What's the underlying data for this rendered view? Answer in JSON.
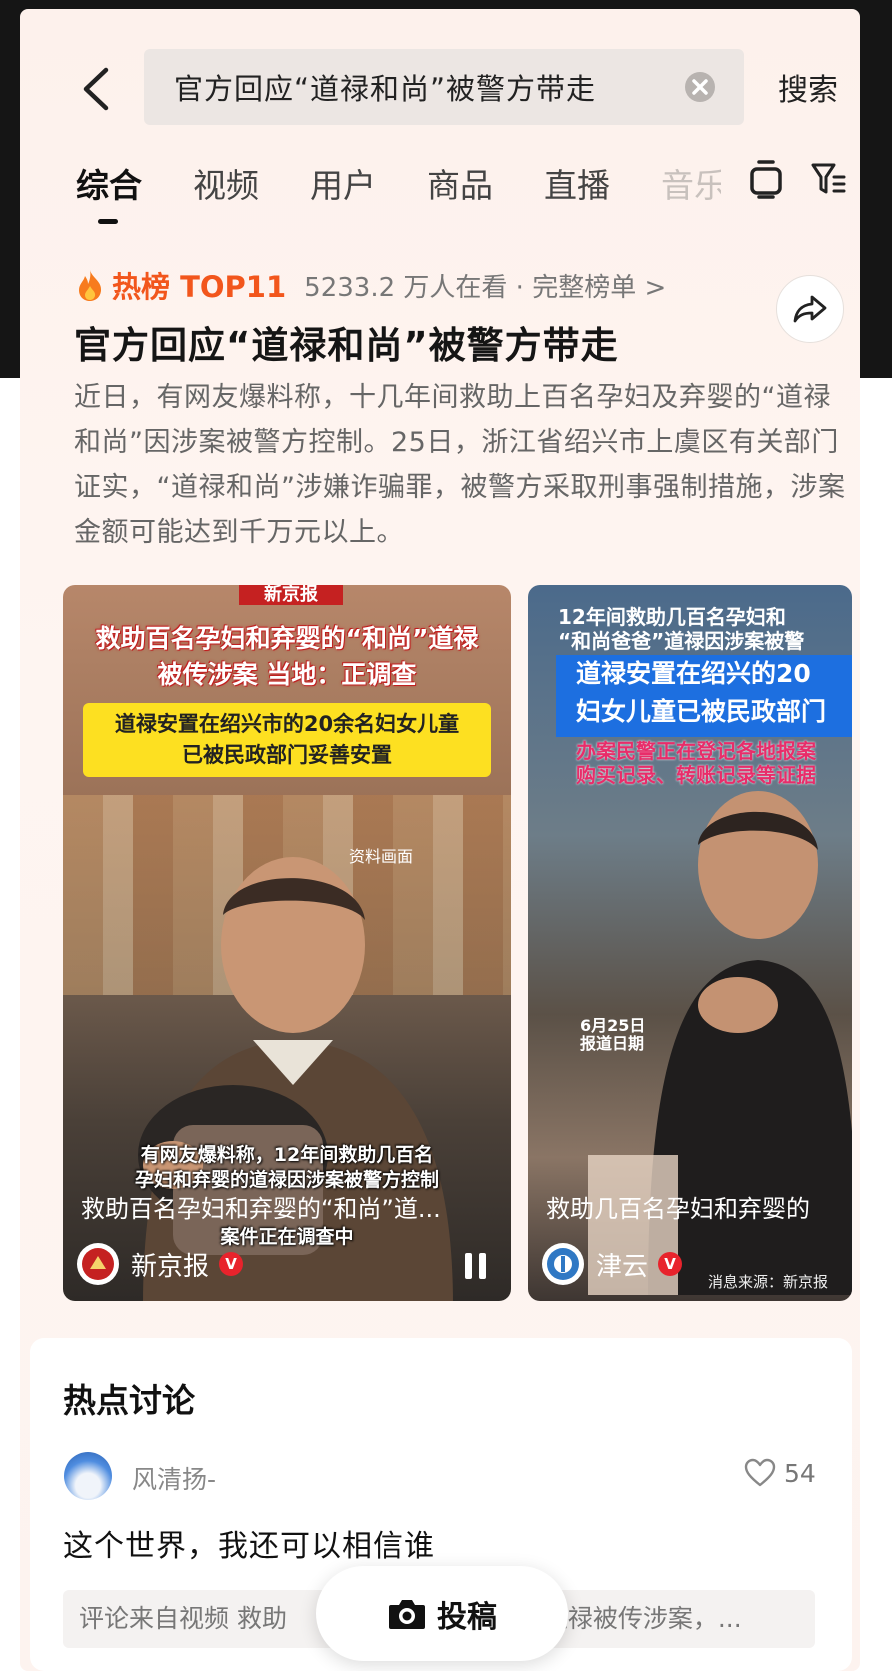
{
  "search": {
    "query": "官方回应“道禄和尚”被警方带走",
    "button_label": "搜索"
  },
  "tabs": [
    "综合",
    "视频",
    "用户",
    "商品",
    "直播",
    "音乐"
  ],
  "hot": {
    "label": "热榜 TOP11",
    "meta": "5233.2 万人在看 · 完整榜单 >"
  },
  "topic": {
    "title": "官方回应“道禄和尚”被警方带走",
    "summary": "近日，有网友爆料称，十几年间救助上百名孕妇及弃婴的“道禄和尚”因涉案被警方控制。25日，浙江省绍兴市上虞区有关部门证实，“道禄和尚”涉嫌诈骗罪，被警方采取刑事强制措施，涉案金额可能达到千万元以上。"
  },
  "videos": [
    {
      "news_tag": "新京报",
      "caption_line1": "救助百名孕妇和弃婴的“和尚”道禄",
      "caption_line2": "被传涉案 当地：正调查",
      "yellow_line1": "道禄安置在绍兴市的20余名妇女儿童",
      "yellow_line2": "已被民政部门妥善安置",
      "data_label": "资料画面",
      "sub_line1": "有网友爆料称，12年间救助几百名",
      "sub_line2": "孕妇和弃婴的道禄因涉案被警方控制",
      "sub_line3": "案件正在调查中",
      "title": "救助百名孕妇和弃婴的“和尚”道...",
      "author": "新京报",
      "verified": "V"
    },
    {
      "caption_line1": "12年间救助几百名孕妇和",
      "caption_line2": "“和尚爸爸”道禄因涉案被警",
      "blue_line1": "道禄安置在绍兴的20",
      "blue_line2": "妇女儿童已被民政部门",
      "pink_line1": "办案民警正在登记各地报案",
      "pink_line2": "购买记录、转账记录等证据",
      "date_line1": "6月25日",
      "date_line2": "报道日期",
      "title": "救助几百名孕妇和弃婴的",
      "author": "津云",
      "verified": "V",
      "source": "消息来源：新京报"
    }
  ],
  "discussion": {
    "title": "热点讨论",
    "user": "风清扬-",
    "likes": "54",
    "comment": "这个世界，我还可以相信谁",
    "from_left": "评论来自视频  救助",
    "from_right": "道禄被传涉案，..."
  },
  "post_button": "投稿",
  "colors": {
    "accent": "#f2561c",
    "verified": "#e8232c",
    "dark_band": "#151515",
    "card_bg": "#fdf1ec"
  },
  "icons": [
    "back-arrow-icon",
    "clear-icon",
    "tv-icon",
    "filter-icon",
    "flame-icon",
    "share-icon",
    "pause-icon",
    "heart-icon",
    "camera-icon"
  ]
}
